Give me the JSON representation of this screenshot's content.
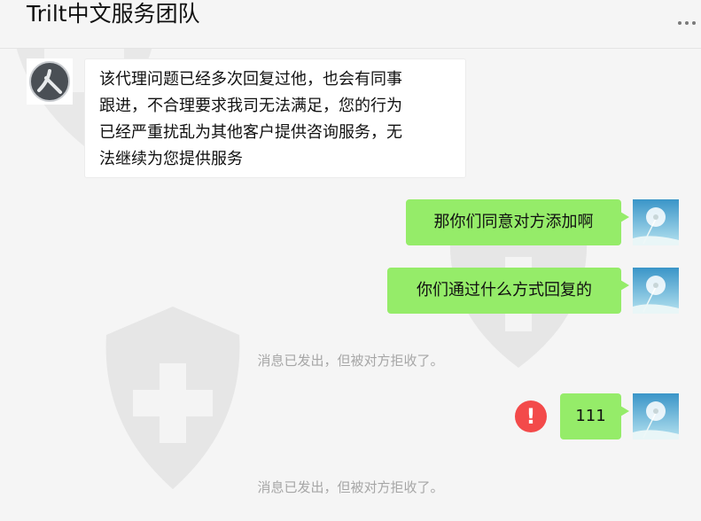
{
  "header": {
    "title": "Trilt中文服务团队",
    "more_icon": "more-horizontal-icon"
  },
  "messages": [
    {
      "direction": "incoming",
      "avatar_icon": "agent-avatar",
      "lines": [
        "该代理问题已经多次回复过他，也会有同事",
        "跟进，不合理要求我司无法满足，您的行为",
        "已经严重扰乱为其他客户提供咨询服务，无",
        "法继续为您提供服务"
      ]
    },
    {
      "direction": "outgoing",
      "avatar_icon": "dandelion-avatar",
      "text": "那你们同意对方添加啊"
    },
    {
      "direction": "outgoing",
      "avatar_icon": "dandelion-avatar",
      "text": "你们通过什么方式回复的"
    },
    {
      "direction": "system",
      "text": "消息已发出，但被对方拒收了。"
    },
    {
      "direction": "outgoing",
      "avatar_icon": "dandelion-avatar",
      "status_icon": "error-icon",
      "status_symbol": "!",
      "text": "111"
    },
    {
      "direction": "system",
      "text": "消息已发出，但被对方拒收了。"
    }
  ],
  "colors": {
    "outgoing_bubble": "#95ec69",
    "incoming_bubble": "#ffffff",
    "error": "#f34a4a",
    "background": "#f5f5f5"
  }
}
